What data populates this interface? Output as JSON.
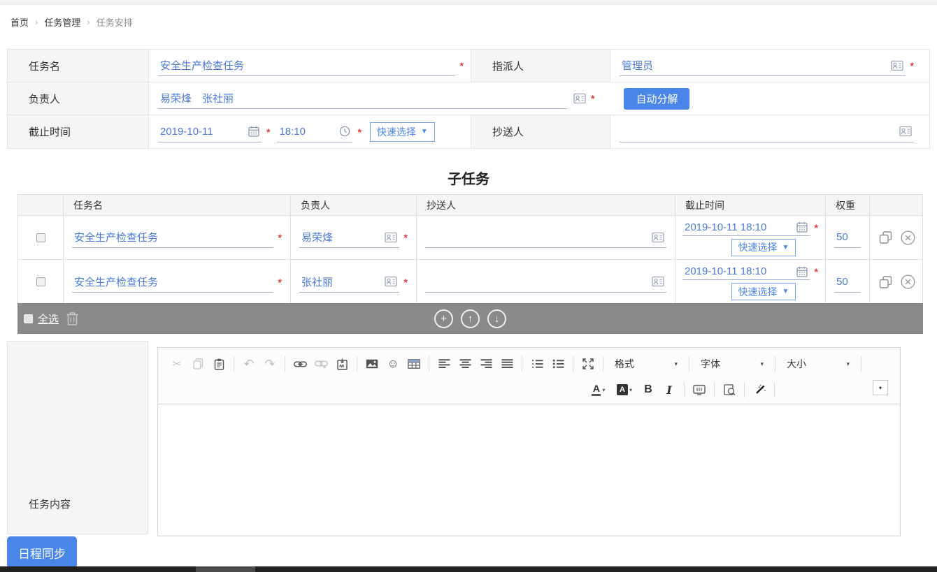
{
  "breadcrumb": {
    "items": [
      "首页",
      "任务管理",
      "任务安排"
    ],
    "separator": "›"
  },
  "form": {
    "required_mark": "*",
    "task_name": {
      "label": "任务名",
      "value": "安全生产检查任务"
    },
    "assigner": {
      "label": "指派人",
      "value": "管理员"
    },
    "owner": {
      "label": "负责人",
      "value": "易荣烽　张社丽"
    },
    "auto_split_label": "自动分解",
    "deadline": {
      "label": "截止时间",
      "date": "2019-10-11",
      "time": "18:10",
      "quick_select_label": "快速选择"
    },
    "cc": {
      "label": "抄送人",
      "value": ""
    }
  },
  "subtasks": {
    "title": "子任务",
    "headers": {
      "task_name": "任务名",
      "owner": "负责人",
      "cc": "抄送人",
      "deadline": "截止时间",
      "weight": "权重"
    },
    "rows": [
      {
        "task_name": "安全生产检查任务",
        "owner": "易荣烽",
        "cc": "",
        "deadline": "2019-10-11 18:10",
        "quick_select_label": "快速选择",
        "weight": "50"
      },
      {
        "task_name": "安全生产检查任务",
        "owner": "张社丽",
        "cc": "",
        "deadline": "2019-10-11 18:10",
        "quick_select_label": "快速选择",
        "weight": "50"
      }
    ],
    "select_all_label": "全选"
  },
  "content": {
    "label": "任务内容"
  },
  "editor": {
    "format_label": "格式",
    "font_label": "字体",
    "size_label": "大小"
  },
  "footer": {
    "sync_label": "日程同步"
  },
  "icons": {
    "scissors": "✂",
    "undo": "↶",
    "redo": "↷",
    "smiley": "☺",
    "plus": "+",
    "arrow_up": "↑",
    "arrow_down": "↓",
    "dropdown_triangle": "▼",
    "caret_down": "▾",
    "bold": "B",
    "italic": "I",
    "letter_a": "A"
  },
  "colors": {
    "accent_blue": "#4a86e8",
    "link_blue": "#4a79d9",
    "required_red": "#e23c3c",
    "bulk_bar_gray": "#8a8a8a",
    "label_bg": "#f5f5f5",
    "border_gray": "#e2e2e2"
  }
}
